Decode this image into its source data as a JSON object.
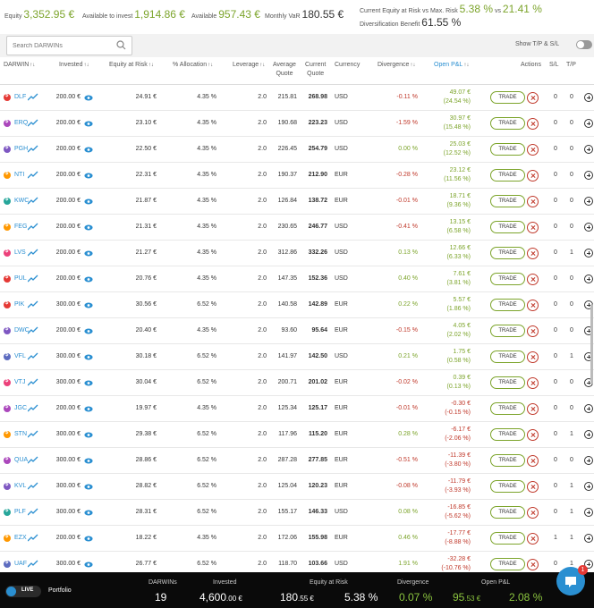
{
  "summary": {
    "equity_label": "Equity",
    "equity_value": "3,352.95 €",
    "available_invest_label": "Available to invest",
    "available_invest_value": "1,914.86 €",
    "available_label": "Available",
    "available_value": "957.43 €",
    "monthly_label": "Monthly VaR",
    "monthly_value": "180.55 €",
    "risk_label": "Current Equity at Risk vs Max. Risk",
    "risk_value": "5.38 %",
    "risk_vs": "vs",
    "risk_max": "21.41 %",
    "div_label": "Diversification Benefit",
    "div_value": "61.55 %"
  },
  "search": {
    "placeholder": "Search DARWINs",
    "icon": "search-icon"
  },
  "toggle": {
    "label": "Show T/P & S/L",
    "state": "off"
  },
  "headers": {
    "darwin": "DARWIN",
    "invested": "Invested",
    "equity_risk": "Equity at Risk",
    "allocation": "% Allocation",
    "leverage": "Leverage",
    "avg1": "Average",
    "avg2": "Quote",
    "cur1": "Current",
    "cur2": "Quote",
    "currency": "Currency",
    "divergence": "Divergence",
    "open_pnl": "Open P&L",
    "actions": "Actions",
    "sl": "S/L",
    "tp": "T/P",
    "sort_glyph": "↑↓"
  },
  "rows": [
    {
      "name": "DLF",
      "color": "#e53935",
      "invested": "200.00 €",
      "ear": "24.91 €",
      "alloc": "4.35 %",
      "lev": "2.0",
      "avg": "215.81",
      "cur": "268.98",
      "ccy": "USD",
      "div": "-0.11 %",
      "divs": "neg",
      "pnl": "49.07 €",
      "pnlp": "(24.54 %)",
      "pnls": "pos",
      "trade": "TRADE",
      "sl": "0",
      "tp": "0"
    },
    {
      "name": "ERQ",
      "color": "#ab47bc",
      "invested": "200.00 €",
      "ear": "23.10 €",
      "alloc": "4.35 %",
      "lev": "2.0",
      "avg": "190.68",
      "cur": "223.23",
      "ccy": "USD",
      "div": "-1.59 %",
      "divs": "neg",
      "pnl": "30.97 €",
      "pnlp": "(15.48 %)",
      "pnls": "pos",
      "trade": "TRADE",
      "sl": "0",
      "tp": "0"
    },
    {
      "name": "PGH",
      "color": "#7e57c2",
      "invested": "200.00 €",
      "ear": "22.50 €",
      "alloc": "4.35 %",
      "lev": "2.0",
      "avg": "226.45",
      "cur": "254.79",
      "ccy": "USD",
      "div": "0.00 %",
      "divs": "pos",
      "pnl": "25.03 €",
      "pnlp": "(12.52 %)",
      "pnls": "pos",
      "trade": "TRADE",
      "sl": "0",
      "tp": "0"
    },
    {
      "name": "NTI",
      "color": "#ff9800",
      "invested": "200.00 €",
      "ear": "22.31 €",
      "alloc": "4.35 %",
      "lev": "2.0",
      "avg": "190.37",
      "cur": "212.90",
      "ccy": "EUR",
      "div": "-0.28 %",
      "divs": "neg",
      "pnl": "23.12 €",
      "pnlp": "(11.56 %)",
      "pnls": "pos",
      "trade": "TRADE",
      "sl": "0",
      "tp": "0"
    },
    {
      "name": "KWC",
      "color": "#26a69a",
      "invested": "200.00 €",
      "ear": "21.87 €",
      "alloc": "4.35 %",
      "lev": "2.0",
      "avg": "126.84",
      "cur": "138.72",
      "ccy": "EUR",
      "div": "-0.01 %",
      "divs": "neg",
      "pnl": "18.71 €",
      "pnlp": "(9.36 %)",
      "pnls": "pos",
      "trade": "TRADE",
      "sl": "0",
      "tp": "0"
    },
    {
      "name": "FEG",
      "color": "#ff9800",
      "invested": "200.00 €",
      "ear": "21.31 €",
      "alloc": "4.35 %",
      "lev": "2.0",
      "avg": "230.65",
      "cur": "246.77",
      "ccy": "USD",
      "div": "-0.41 %",
      "divs": "neg",
      "pnl": "13.15 €",
      "pnlp": "(6.58 %)",
      "pnls": "pos",
      "trade": "TRADE",
      "sl": "0",
      "tp": "0"
    },
    {
      "name": "LVS",
      "color": "#ec407a",
      "invested": "200.00 €",
      "ear": "21.27 €",
      "alloc": "4.35 %",
      "lev": "2.0",
      "avg": "312.86",
      "cur": "332.26",
      "ccy": "USD",
      "div": "0.13 %",
      "divs": "pos",
      "pnl": "12.66 €",
      "pnlp": "(6.33 %)",
      "pnls": "pos",
      "trade": "TRADE",
      "sl": "0",
      "tp": "1"
    },
    {
      "name": "PUL",
      "color": "#e53935",
      "invested": "200.00 €",
      "ear": "20.76 €",
      "alloc": "4.35 %",
      "lev": "2.0",
      "avg": "147.35",
      "cur": "152.36",
      "ccy": "USD",
      "div": "0.40 %",
      "divs": "pos",
      "pnl": "7.61 €",
      "pnlp": "(3.81 %)",
      "pnls": "pos",
      "trade": "TRADE",
      "sl": "0",
      "tp": "0"
    },
    {
      "name": "PIK",
      "color": "#e53935",
      "invested": "300.00 €",
      "ear": "30.56 €",
      "alloc": "6.52 %",
      "lev": "2.0",
      "avg": "140.58",
      "cur": "142.89",
      "ccy": "EUR",
      "div": "0.22 %",
      "divs": "pos",
      "pnl": "5.57 €",
      "pnlp": "(1.86 %)",
      "pnls": "pos",
      "trade": "TRADE",
      "sl": "0",
      "tp": "0"
    },
    {
      "name": "DWC",
      "color": "#7e57c2",
      "invested": "200.00 €",
      "ear": "20.40 €",
      "alloc": "4.35 %",
      "lev": "2.0",
      "avg": "93.60",
      "cur": "95.64",
      "ccy": "EUR",
      "div": "-0.15 %",
      "divs": "neg",
      "pnl": "4.05 €",
      "pnlp": "(2.02 %)",
      "pnls": "pos",
      "trade": "TRADE",
      "sl": "0",
      "tp": "0"
    },
    {
      "name": "VFL",
      "color": "#5c6bc0",
      "invested": "300.00 €",
      "ear": "30.18 €",
      "alloc": "6.52 %",
      "lev": "2.0",
      "avg": "141.97",
      "cur": "142.50",
      "ccy": "USD",
      "div": "0.21 %",
      "divs": "pos",
      "pnl": "1.75 €",
      "pnlp": "(0.58 %)",
      "pnls": "pos",
      "trade": "TRADE",
      "sl": "0",
      "tp": "1"
    },
    {
      "name": "VTJ",
      "color": "#ec407a",
      "invested": "300.00 €",
      "ear": "30.04 €",
      "alloc": "6.52 %",
      "lev": "2.0",
      "avg": "200.71",
      "cur": "201.02",
      "ccy": "EUR",
      "div": "-0.02 %",
      "divs": "neg",
      "pnl": "0.39 €",
      "pnlp": "(0.13 %)",
      "pnls": "pos",
      "trade": "TRADE",
      "sl": "0",
      "tp": "0"
    },
    {
      "name": "JGC",
      "color": "#ab47bc",
      "invested": "200.00 €",
      "ear": "19.97 €",
      "alloc": "4.35 %",
      "lev": "2.0",
      "avg": "125.34",
      "cur": "125.17",
      "ccy": "EUR",
      "div": "-0.01 %",
      "divs": "neg",
      "pnl": "-0.30 €",
      "pnlp": "(-0.15 %)",
      "pnls": "neg",
      "trade": "TRADE",
      "sl": "0",
      "tp": "0"
    },
    {
      "name": "STN",
      "color": "#ff9800",
      "invested": "300.00 €",
      "ear": "29.38 €",
      "alloc": "6.52 %",
      "lev": "2.0",
      "avg": "117.96",
      "cur": "115.20",
      "ccy": "EUR",
      "div": "0.28 %",
      "divs": "pos",
      "pnl": "-6.17 €",
      "pnlp": "(-2.06 %)",
      "pnls": "neg",
      "trade": "TRADE",
      "sl": "0",
      "tp": "1"
    },
    {
      "name": "QUA",
      "color": "#ab47bc",
      "invested": "300.00 €",
      "ear": "28.86 €",
      "alloc": "6.52 %",
      "lev": "2.0",
      "avg": "287.28",
      "cur": "277.85",
      "ccy": "EUR",
      "div": "-0.51 %",
      "divs": "neg",
      "pnl": "-11.39 €",
      "pnlp": "(-3.80 %)",
      "pnls": "neg",
      "trade": "TRADE",
      "sl": "0",
      "tp": "0"
    },
    {
      "name": "KVL",
      "color": "#7e57c2",
      "invested": "300.00 €",
      "ear": "28.82 €",
      "alloc": "6.52 %",
      "lev": "2.0",
      "avg": "125.04",
      "cur": "120.23",
      "ccy": "EUR",
      "div": "-0.08 %",
      "divs": "neg",
      "pnl": "-11.79 €",
      "pnlp": "(-3.93 %)",
      "pnls": "neg",
      "trade": "TRADE",
      "sl": "0",
      "tp": "1"
    },
    {
      "name": "PLF",
      "color": "#26a69a",
      "invested": "300.00 €",
      "ear": "28.31 €",
      "alloc": "6.52 %",
      "lev": "2.0",
      "avg": "155.17",
      "cur": "146.33",
      "ccy": "USD",
      "div": "0.08 %",
      "divs": "pos",
      "pnl": "-16.85 €",
      "pnlp": "(-5.62 %)",
      "pnls": "neg",
      "trade": "TRADE",
      "sl": "0",
      "tp": "1"
    },
    {
      "name": "EZX",
      "color": "#ff9800",
      "invested": "200.00 €",
      "ear": "18.22 €",
      "alloc": "4.35 %",
      "lev": "2.0",
      "avg": "172.06",
      "cur": "155.98",
      "ccy": "EUR",
      "div": "0.46 %",
      "divs": "pos",
      "pnl": "-17.77 €",
      "pnlp": "(-8.88 %)",
      "pnls": "neg",
      "trade": "TRADE",
      "sl": "1",
      "tp": "1"
    },
    {
      "name": "UAF",
      "color": "#5c6bc0",
      "invested": "300.00 €",
      "ear": "26.77 €",
      "alloc": "6.52 %",
      "lev": "2.0",
      "avg": "118.70",
      "cur": "103.66",
      "ccy": "USD",
      "div": "1.91 %",
      "divs": "pos",
      "pnl": "-32.28 €",
      "pnlp": "(-10.76 %)",
      "pnls": "neg",
      "trade": "TRADE",
      "sl": "0",
      "tp": "1"
    }
  ],
  "footer": {
    "live_label": "LIVE",
    "portfolio": "Portfolio",
    "darwins_label": "DARWINs",
    "darwins_value": "19",
    "invested_label": "Invested",
    "invested_main": "4,600",
    "invested_dec": ".00 €",
    "ear_label": "Equity at Risk",
    "ear_main": "180",
    "ear_dec": ".55 €",
    "ear_pct": "5.38 %",
    "div_label": "Divergence",
    "div_value": "0.07 %",
    "pnl_label": "Open P&L",
    "pnl_main": "95",
    "pnl_dec": ".53 €",
    "pnl_pct": "2.08 %",
    "chat_badge": "1"
  }
}
